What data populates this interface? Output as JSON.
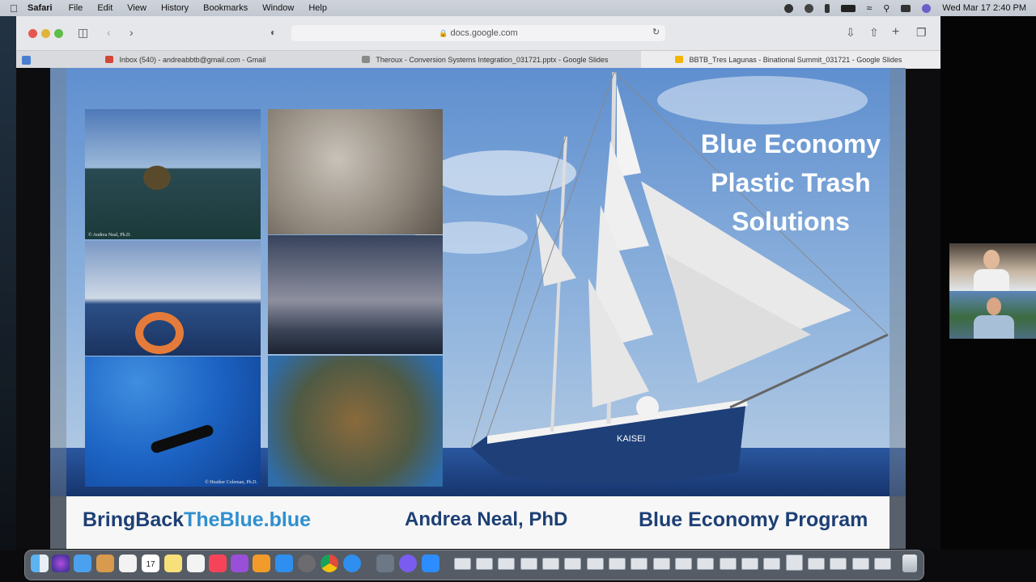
{
  "menubar": {
    "app_name": "Safari",
    "menus": [
      "File",
      "Edit",
      "View",
      "History",
      "Bookmarks",
      "Window",
      "Help"
    ],
    "clock": "Wed Mar 17  2:40 PM"
  },
  "browser": {
    "address": "docs.google.com",
    "tabs": [
      {
        "label": "Inbox (540) - andreabbtb@gmail.com - Gmail",
        "favicon_color": "#d44638"
      },
      {
        "label": "Theroux - Conversion Systems Integration_031721.pptx - Google Slides",
        "favicon_color": "#8a8a8a"
      },
      {
        "label": "BBTB_Tres Lagunas - Binational Summit_031721 - Google Slides",
        "favicon_color": "#f4b400"
      }
    ],
    "active_tab": 2
  },
  "slide": {
    "title_lines": [
      "Blue Economy",
      "Plastic Trash",
      "Solutions"
    ],
    "photo_credits": {
      "first": "© Andrea Neal, Ph.D.",
      "second": "© Heather Coleman, Ph.D."
    },
    "ship_name": "KAISEI",
    "footer": {
      "brand_part1": "BringBack",
      "brand_part2": "TheBlue.blue",
      "presenter": "Andrea Neal, PhD",
      "program": "Blue Economy Program"
    },
    "colors": {
      "footer_navy": "#1d3f74",
      "footer_accent": "#2f8fcf",
      "sky": "#7fa8d8",
      "ocean": "#1e3f78"
    }
  },
  "dock": {
    "apps": [
      "finder-icon",
      "siri-icon",
      "mail-icon",
      "launchpad-icon",
      "calendar-icon",
      "notes-icon",
      "music-icon",
      "podcasts-icon",
      "books-icon",
      "app-store-icon",
      "settings-icon",
      "chrome-icon",
      "safari-icon",
      "preview-icon",
      "messenger-icon",
      "zoom-icon"
    ],
    "calendar_day": "17"
  }
}
